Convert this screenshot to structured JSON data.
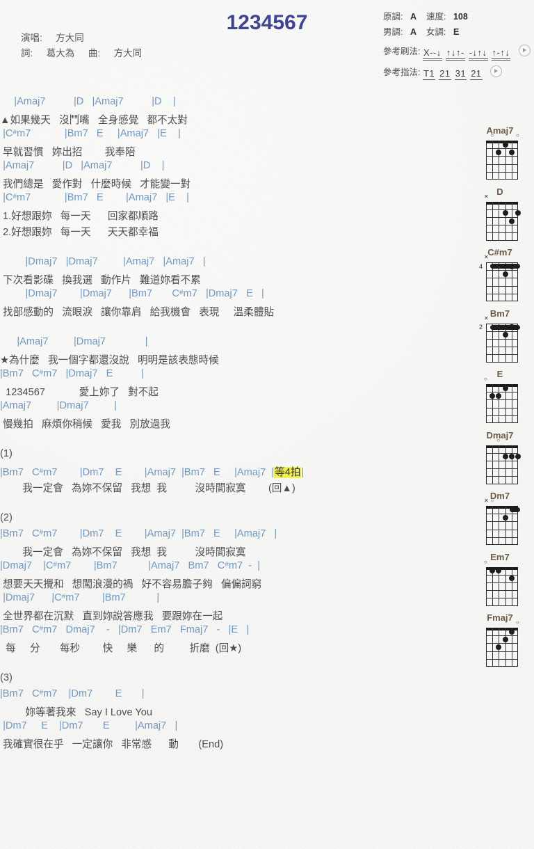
{
  "header": {
    "title": "1234567",
    "singer_label": "演唱:",
    "singer": "方大同",
    "lyricist_label": "詞:",
    "lyricist": "葛大為",
    "composer_label": "曲:",
    "composer": "方大同",
    "original_key_label": "原調:",
    "original_key": "A",
    "tempo_label": "速度:",
    "tempo": "108",
    "male_key_label": "男調:",
    "male_key": "A",
    "female_key_label": "女調:",
    "female_key": "E",
    "strum_label": "參考刷法:",
    "strum_pattern": [
      "X--↓",
      "↑↓↑-",
      "-↓↑↓",
      "↑-↑↓"
    ],
    "fingerstyle_label": "參考指法:",
    "fingerstyle_pattern": [
      "T1",
      "21",
      "31",
      "21"
    ],
    "play_icon": "play-icon"
  },
  "colors": {
    "title": "#3f4494",
    "chord": "#6f97c7",
    "lyric": "#4e4e4e",
    "diagram_name": "#6b5b45",
    "highlight": "#f2f04a",
    "page_bg": "#f7f7f5"
  },
  "song": {
    "blocks": [
      {
        "lines": [
          {
            "type": "chords",
            "text": "     |Amaj7          |D   |Amaj7          |D    |"
          },
          {
            "type": "lyrics",
            "text": "▲如果幾天   沒鬥嘴   全身感覺   都不太對"
          },
          {
            "type": "chords",
            "text": " |C#m7            |Bm7   E     |Amaj7   |E    |"
          },
          {
            "type": "lyrics",
            "text": " 早就習慣   妳出招        我奉陪"
          },
          {
            "type": "chords",
            "text": " |Amaj7          |D   |Amaj7          |D    |"
          },
          {
            "type": "lyrics",
            "text": " 我們總是   愛作對   什麼時候   才能變一對"
          },
          {
            "type": "chords",
            "text": " |C#m7            |Bm7   E        |Amaj7   |E    |"
          },
          {
            "type": "lyrics",
            "text": " 1.好想跟妳   每一天      回家都順路"
          },
          {
            "type": "lyrics",
            "text": " 2.好想跟妳   每一天      天天都幸福"
          }
        ]
      },
      {
        "lines": [
          {
            "type": "chords",
            "text": "         |Dmaj7   |Dmaj7         |Amaj7   |Amaj7   |"
          },
          {
            "type": "lyrics",
            "text": " 下次看影碟   換我選   動作片   難道妳看不累"
          },
          {
            "type": "chords",
            "text": "         |Dmaj7        |Dmaj7      |Bm7       C#m7   |Dmaj7   E   |"
          },
          {
            "type": "lyrics",
            "text": " 找部感動的   流眼淚   讓你靠肩   給我機會   表現     溫柔體貼"
          }
        ]
      },
      {
        "lines": [
          {
            "type": "chords",
            "text": "      |Amaj7         |Dmaj7              |"
          },
          {
            "type": "lyrics",
            "text": "★為什麼   我一個字都還沒說   明明是該表態時候"
          },
          {
            "type": "chords",
            "text": "|Bm7   C#m7   |Dmaj7   E          |"
          },
          {
            "type": "lyrics",
            "text": "  1234567            愛上妳了   對不起"
          },
          {
            "type": "chords",
            "text": "|Amaj7         |Dmaj7         |"
          },
          {
            "type": "lyrics",
            "text": " 慢幾拍   麻煩你稍候   愛我   別放過我"
          }
        ]
      },
      {
        "lines": [
          {
            "type": "label",
            "text": "(1)"
          },
          {
            "type": "chords",
            "text": "|Bm7   C#m7        |Dm7    E        |Amaj7  |Bm7   E     |Amaj7  |等4拍|",
            "highlight": "等4拍"
          },
          {
            "type": "lyrics",
            "text": "        我一定會   為妳不保留   我想  我          沒時間寂寞        (回▲)"
          }
        ]
      },
      {
        "lines": [
          {
            "type": "label",
            "text": "(2)"
          },
          {
            "type": "chords",
            "text": "|Bm7   C#m7        |Dm7    E        |Amaj7  |Bm7   E     |Amaj7   |"
          },
          {
            "type": "lyrics",
            "text": "        我一定會   為妳不保留   我想  我          沒時間寂寞"
          },
          {
            "type": "chords",
            "text": "|Dmaj7    |C#m7        |Bm7           |Amaj7   Bm7   C#m7  -  |"
          },
          {
            "type": "lyrics",
            "text": " 想要天天攪和   想闖浪漫的禍   好不容易膽子夠   偏偏詞窮"
          },
          {
            "type": "chords",
            "text": " |Dmaj7      |C#m7        |Bm7           |"
          },
          {
            "type": "lyrics",
            "text": " 全世界都在沉默   直到妳說答應我   要跟妳在一起"
          },
          {
            "type": "chords",
            "text": "|Bm7   C#m7   Dmaj7    -   |Dm7   Em7   Fmaj7   -   |E   |"
          },
          {
            "type": "lyrics",
            "text": "  每     分       每秒        快     樂      的         折磨  (回★)"
          }
        ]
      },
      {
        "lines": [
          {
            "type": "label",
            "text": "(3)"
          },
          {
            "type": "chords",
            "text": "|Bm7   C#m7    |Dm7        E       |"
          },
          {
            "type": "lyrics",
            "text": "         妳等著我來   Say I Love You"
          },
          {
            "type": "chords",
            "text": " |Dm7     E    |Dm7       E         |Amaj7   |"
          },
          {
            "type": "lyrics",
            "text": " 我確實很在乎   一定讓你   非常感      動       (End)"
          }
        ]
      }
    ]
  },
  "diagrams": [
    {
      "name": "Amaj7",
      "base_fret": "",
      "nut": true,
      "markers": [
        {
          "string": 5,
          "sym": "o"
        },
        {
          "string": 1,
          "sym": "o"
        }
      ],
      "dots": [
        {
          "string": 3,
          "fret": 1
        },
        {
          "string": 4,
          "fret": 2
        },
        {
          "string": 2,
          "fret": 2
        }
      ],
      "barre": null
    },
    {
      "name": "D",
      "base_fret": "",
      "nut": true,
      "markers": [
        {
          "string": 6,
          "sym": "x"
        }
      ],
      "dots": [
        {
          "string": 3,
          "fret": 2
        },
        {
          "string": 1,
          "fret": 2
        },
        {
          "string": 2,
          "fret": 3
        }
      ],
      "barre": null
    },
    {
      "name": "C#m7",
      "base_fret": "4",
      "nut": false,
      "markers": [
        {
          "string": 6,
          "sym": "x"
        }
      ],
      "dots": [
        {
          "string": 3,
          "fret": 2
        },
        {
          "string": 2,
          "fret": 1
        }
      ],
      "barre": {
        "fret": 1,
        "from": 5,
        "to": 1
      }
    },
    {
      "name": "Bm7",
      "base_fret": "2",
      "nut": false,
      "markers": [
        {
          "string": 6,
          "sym": "x"
        }
      ],
      "dots": [
        {
          "string": 3,
          "fret": 2
        },
        {
          "string": 2,
          "fret": 1
        }
      ],
      "barre": {
        "fret": 1,
        "from": 5,
        "to": 1
      }
    },
    {
      "name": "E",
      "base_fret": "",
      "nut": true,
      "markers": [
        {
          "string": 6,
          "sym": "o"
        }
      ],
      "dots": [
        {
          "string": 3,
          "fret": 1
        },
        {
          "string": 5,
          "fret": 2
        },
        {
          "string": 4,
          "fret": 2
        }
      ],
      "barre": null
    },
    {
      "name": "Dmaj7",
      "base_fret": "",
      "nut": true,
      "markers": [
        {
          "string": 4,
          "sym": "o"
        }
      ],
      "dots": [
        {
          "string": 3,
          "fret": 2
        },
        {
          "string": 2,
          "fret": 2
        },
        {
          "string": 1,
          "fret": 2
        }
      ],
      "barre": null
    },
    {
      "name": "Dm7",
      "base_fret": "",
      "nut": true,
      "markers": [
        {
          "string": 6,
          "sym": "x"
        },
        {
          "string": 5,
          "sym": "o"
        }
      ],
      "dots": [
        {
          "string": 3,
          "fret": 2
        }
      ],
      "barre": {
        "fret": 1,
        "from": 2,
        "to": 1
      }
    },
    {
      "name": "Em7",
      "base_fret": "",
      "nut": true,
      "markers": [
        {
          "string": 6,
          "sym": "o"
        }
      ],
      "dots": [
        {
          "string": 5,
          "fret": 1
        },
        {
          "string": 4,
          "fret": 1
        },
        {
          "string": 2,
          "fret": 2
        }
      ],
      "barre": null
    },
    {
      "name": "Fmaj7",
      "base_fret": "",
      "nut": true,
      "markers": [
        {
          "string": 1,
          "sym": "o"
        }
      ],
      "dots": [
        {
          "string": 2,
          "fret": 1
        },
        {
          "string": 3,
          "fret": 2
        },
        {
          "string": 4,
          "fret": 3
        }
      ],
      "barre": null
    }
  ]
}
